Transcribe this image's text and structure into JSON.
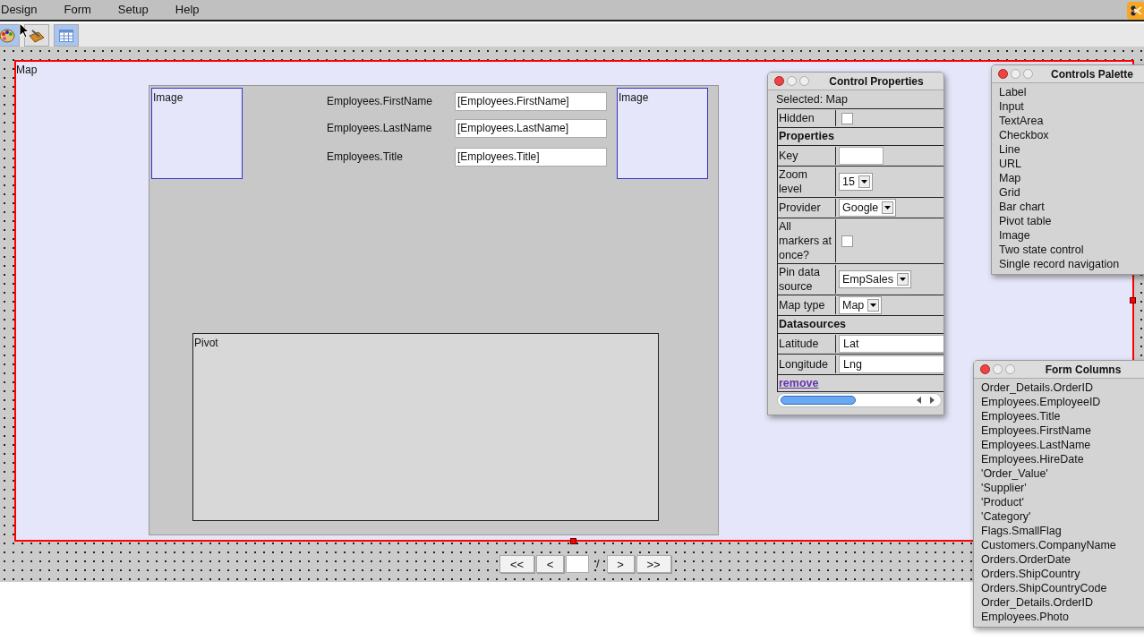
{
  "menu": [
    "Design",
    "Form",
    "Setup",
    "Help"
  ],
  "toolbar": [
    {
      "kind": "palette",
      "selected": true
    },
    {
      "kind": "toolbox",
      "selected": false
    },
    {
      "kind": "table",
      "selected": true
    }
  ],
  "canvas": {
    "map_label": "Map",
    "images": [
      {
        "label": "Image"
      },
      {
        "label": "Image"
      }
    ],
    "fields": [
      {
        "label": "Employees.FirstName",
        "value": "[Employees.FirstName]"
      },
      {
        "label": "Employees.LastName",
        "value": "[Employees.LastName]"
      },
      {
        "label": "Employees.Title",
        "value": "[Employees.Title]"
      }
    ],
    "pivot_label": "Pivot"
  },
  "navigation": {
    "buttons": [
      "<<",
      "<"
    ],
    "separator": "/",
    "buttons_after": [
      ">",
      ">>"
    ]
  },
  "control_properties": {
    "title": "Control Properties",
    "selected_label": "Selected: Map",
    "rows": [
      {
        "kind": "checkbox",
        "label": "Hidden",
        "checked": false
      },
      {
        "kind": "section",
        "label": "Properties"
      },
      {
        "kind": "input",
        "label": "Key"
      },
      {
        "kind": "select",
        "label": "Zoom level",
        "value": "15"
      },
      {
        "kind": "select",
        "label": "Provider",
        "value": "Google"
      },
      {
        "kind": "checkbox",
        "label": "All markers at once?",
        "checked": false
      },
      {
        "kind": "select",
        "label": "Pin data source",
        "value": "EmpSales"
      },
      {
        "kind": "select",
        "label": "Map type",
        "value": "Map"
      },
      {
        "kind": "section",
        "label": "Datasources"
      },
      {
        "kind": "input",
        "label": "Latitude",
        "value": "Lat"
      },
      {
        "kind": "input",
        "label": "Longitude",
        "value": "Lng"
      },
      {
        "kind": "link",
        "label": "remove"
      }
    ]
  },
  "controls_palette": {
    "title": "Controls Palette",
    "items": [
      "Label",
      "Input",
      "TextArea",
      "Checkbox",
      "Line",
      "URL",
      "Map",
      "Grid",
      "Bar chart",
      "Pivot table",
      "Image",
      "Two state control",
      "Single record navigation"
    ]
  },
  "form_columns": {
    "title": "Form Columns",
    "items": [
      "Order_Details.OrderID",
      "Employees.EmployeeID",
      "Employees.Title",
      "Employees.FirstName",
      "Employees.LastName",
      "Employees.HireDate",
      "'Order_Value'",
      "'Supplier'",
      "'Product'",
      "'Category'",
      "Flags.SmallFlag",
      "Customers.CompanyName",
      "Orders.OrderDate",
      "Orders.ShipCountry",
      "Orders.ShipCountryCode",
      "Order_Details.OrderID",
      "Employees.Photo"
    ]
  }
}
